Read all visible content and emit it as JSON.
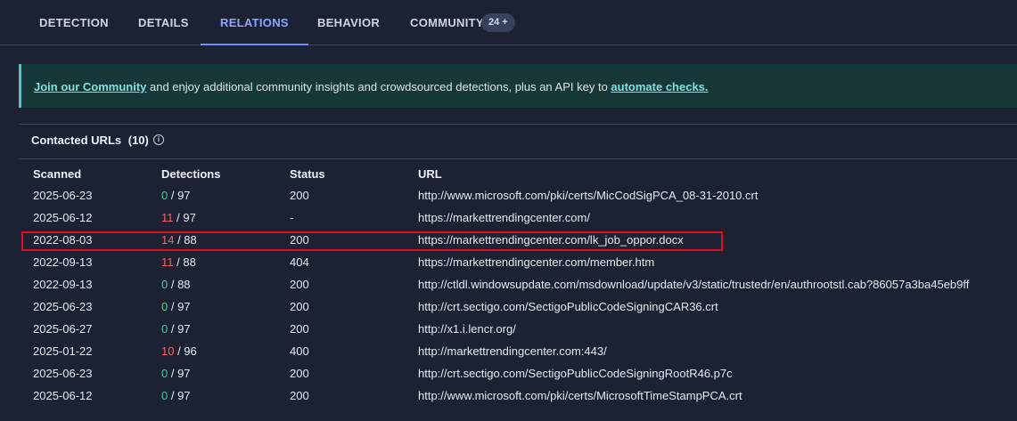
{
  "tabs": [
    {
      "label": "DETECTION"
    },
    {
      "label": "DETAILS"
    },
    {
      "label": "RELATIONS"
    },
    {
      "label": "BEHAVIOR"
    },
    {
      "label": "COMMUNITY"
    }
  ],
  "community_badge": "24 +",
  "banner": {
    "link1": "Join our Community",
    "text": " and enjoy additional community insights and crowdsourced detections, plus an API key to ",
    "link2": "automate checks."
  },
  "contacted_urls": {
    "title": "Contacted URLs",
    "count": "(10)",
    "columns": [
      "Scanned",
      "Detections",
      "Status",
      "URL"
    ],
    "rows": [
      {
        "scanned": "2025-06-23",
        "detections": "0",
        "total": " / 97",
        "status": "200",
        "url": "http://www.microsoft.com/pki/certs/MicCodSigPCA_08-31-2010.crt"
      },
      {
        "scanned": "2025-06-12",
        "detections": "11",
        "total": " / 97",
        "status": "-",
        "url": "https://markettrendingcenter.com/"
      },
      {
        "scanned": "2022-08-03",
        "detections": "14",
        "total": " / 88",
        "status": "200",
        "url": "https://markettrendingcenter.com/lk_job_oppor.docx"
      },
      {
        "scanned": "2022-09-13",
        "detections": "11",
        "total": " / 88",
        "status": "404",
        "url": "https://markettrendingcenter.com/member.htm"
      },
      {
        "scanned": "2022-09-13",
        "detections": "0",
        "total": " / 88",
        "status": "200",
        "url": "http://ctldl.windowsupdate.com/msdownload/update/v3/static/trustedr/en/authrootstl.cab?86057a3ba45eb9ff"
      },
      {
        "scanned": "2025-06-23",
        "detections": "0",
        "total": " / 97",
        "status": "200",
        "url": "http://crt.sectigo.com/SectigoPublicCodeSigningCAR36.crt"
      },
      {
        "scanned": "2025-06-27",
        "detections": "0",
        "total": " / 97",
        "status": "200",
        "url": "http://x1.i.lencr.org/"
      },
      {
        "scanned": "2025-01-22",
        "detections": "10",
        "total": " / 96",
        "status": "400",
        "url": "http://markettrendingcenter.com:443/"
      },
      {
        "scanned": "2025-06-23",
        "detections": "0",
        "total": " / 97",
        "status": "200",
        "url": "http://crt.sectigo.com/SectigoPublicCodeSigningRootR46.p7c"
      },
      {
        "scanned": "2025-06-12",
        "detections": "0",
        "total": " / 97",
        "status": "200",
        "url": "http://www.microsoft.com/pki/certs/MicrosoftTimeStampPCA.crt"
      }
    ]
  },
  "colors": {
    "clean": "#4cc59a",
    "malicious": "#ff5f5f",
    "accent": "#8aa6ff",
    "highlight_box": "#e0101a"
  },
  "icons": {
    "info": "info-icon"
  }
}
